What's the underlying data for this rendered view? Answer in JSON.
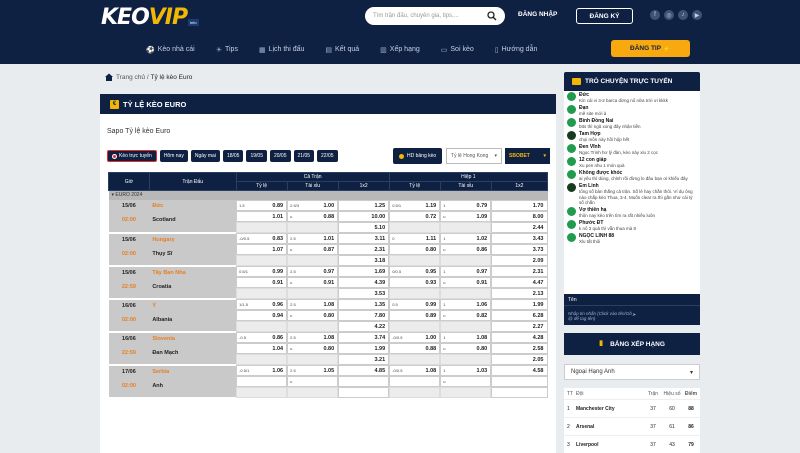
{
  "header": {
    "logo_main": "KEO",
    "logo_accent": "VIP",
    "logo_tag": "info",
    "search_placeholder": "Tìm trận đấu, chuyên gia, tips,...",
    "login_label": "ĐĂNG NHẬP",
    "register_label": "ĐĂNG KÝ",
    "socials": [
      "facebook-icon",
      "instagram-icon",
      "tiktok-icon",
      "youtube-icon"
    ]
  },
  "nav": {
    "items": [
      {
        "label": "Kèo nhà cái",
        "icon": "ball-icon"
      },
      {
        "label": "Tips",
        "icon": "lightbulb-icon"
      },
      {
        "label": "Lịch thi đấu",
        "icon": "calendar-icon"
      },
      {
        "label": "Kết quả",
        "icon": "scoreboard-icon"
      },
      {
        "label": "Xếp hạng",
        "icon": "ranking-icon"
      },
      {
        "label": "Soi kèo",
        "icon": "tv-icon"
      },
      {
        "label": "Hướng dẫn",
        "icon": "book-icon"
      }
    ],
    "dangtip_label": "ĐĂNG TIP"
  },
  "breadcrumb": {
    "home": "Trang chủ",
    "sep": "/",
    "current": "Tỷ lệ kèo Euro"
  },
  "main": {
    "title": "TỶ LỆ KÈO EURO",
    "sapo": "Sapo Tỷ lệ kèo Euro",
    "filters": [
      "Kèo trực tuyến",
      "Hôm nay",
      "Ngày mai",
      "18/05",
      "19/05",
      "20/05",
      "21/05",
      "22/05"
    ],
    "hd_label": "HD bảng kèo",
    "region_select": "Tỷ lệ Hong Kong",
    "bookmaker_select": "SBOBET"
  },
  "table": {
    "h_time": "Giờ",
    "h_match": "Trận Đấu",
    "h_full": "Cả Trận",
    "h_half": "Hiệp 1",
    "h_tyle": "Tỷ lệ",
    "h_taixiu": "Tài xỉu",
    "h_1x2": "1x2",
    "league": "EURO 2024",
    "matches": [
      {
        "date": "15/06",
        "time": "02:00",
        "home": "Đức",
        "away": "Scotland",
        "ft_hdp_line": "1.5",
        "ft_hdp_home": "0.89",
        "ft_hdp_away": "1.01",
        "ft_ou_line": "2.5/3",
        "ft_ou_over": "1.00",
        "ft_ou_under": "0.88",
        "ft_1x2": [
          "1.25",
          "10.00",
          "5.10"
        ],
        "h1_hdp_line": "0.5/1",
        "h1_hdp_home": "1.19",
        "h1_hdp_away": "0.72",
        "h1_ou_line": "1",
        "h1_ou_over": "0.79",
        "h1_ou_under": "1.09",
        "h1_1x2": [
          "1.70",
          "8.00",
          "2.44"
        ]
      },
      {
        "date": "15/06",
        "time": "02:00",
        "home": "Hungary",
        "away": "Thụy Sĩ",
        "ft_hdp_line": "-0/0.5",
        "ft_hdp_home": "0.83",
        "ft_hdp_away": "1.07",
        "ft_ou_line": "2.5",
        "ft_ou_over": "1.01",
        "ft_ou_under": "0.87",
        "ft_1x2": [
          "3.11",
          "2.31",
          "3.18"
        ],
        "h1_hdp_line": "0",
        "h1_hdp_home": "1.11",
        "h1_hdp_away": "0.80",
        "h1_ou_line": "1",
        "h1_ou_over": "1.02",
        "h1_ou_under": "0.86",
        "h1_1x2": [
          "3.43",
          "3.73",
          "2.09"
        ]
      },
      {
        "date": "15/06",
        "time": "22:59",
        "home": "Tây Ban Nha",
        "away": "Croatia",
        "ft_hdp_line": "0.5/1",
        "ft_hdp_home": "0.99",
        "ft_hdp_away": "0.91",
        "ft_ou_line": "2.5",
        "ft_ou_over": "0.97",
        "ft_ou_under": "0.91",
        "ft_1x2": [
          "1.69",
          "4.39",
          "3.53"
        ],
        "h1_hdp_line": "0/0.5",
        "h1_hdp_home": "0.95",
        "h1_hdp_away": "0.93",
        "h1_ou_line": "1",
        "h1_ou_over": "0.97",
        "h1_ou_under": "0.91",
        "h1_1x2": [
          "2.31",
          "4.47",
          "2.13"
        ]
      },
      {
        "date": "16/06",
        "time": "02:00",
        "home": "Ý",
        "away": "Albania",
        "ft_hdp_line": "1/1.5",
        "ft_hdp_home": "0.96",
        "ft_hdp_away": "0.94",
        "ft_ou_line": "2.5",
        "ft_ou_over": "1.08",
        "ft_ou_under": "0.80",
        "ft_1x2": [
          "1.35",
          "7.80",
          "4.22"
        ],
        "h1_hdp_line": "0.5",
        "h1_hdp_home": "0.99",
        "h1_hdp_away": "0.89",
        "h1_ou_line": "1",
        "h1_ou_over": "1.06",
        "h1_ou_under": "0.82",
        "h1_1x2": [
          "1.99",
          "6.28",
          "2.27"
        ]
      },
      {
        "date": "16/06",
        "time": "22:59",
        "home": "Slovenia",
        "away": "Đan Mạch",
        "ft_hdp_line": "-0.5",
        "ft_hdp_home": "0.86",
        "ft_hdp_away": "1.04",
        "ft_ou_line": "2.5",
        "ft_ou_over": "1.08",
        "ft_ou_under": "0.80",
        "ft_1x2": [
          "3.74",
          "1.99",
          "3.21"
        ],
        "h1_hdp_line": "-0/0.5",
        "h1_hdp_home": "1.00",
        "h1_hdp_away": "0.88",
        "h1_ou_line": "1",
        "h1_ou_over": "1.08",
        "h1_ou_under": "0.80",
        "h1_1x2": [
          "4.28",
          "2.58",
          "2.05"
        ]
      },
      {
        "date": "17/06",
        "time": "02:00",
        "home": "Serbia",
        "away": "Anh",
        "ft_hdp_line": "-0.5/1",
        "ft_hdp_home": "1.06",
        "ft_hdp_away": "",
        "ft_ou_line": "2.5",
        "ft_ou_over": "1.05",
        "ft_ou_under": "",
        "ft_1x2": [
          "4.85",
          "",
          ""
        ],
        "h1_hdp_line": "-0/0.5",
        "h1_hdp_home": "1.08",
        "h1_hdp_away": "",
        "h1_ou_line": "1",
        "h1_ou_over": "1.03",
        "h1_ou_under": "",
        "h1_1x2": [
          "4.58",
          "",
          ""
        ]
      }
    ]
  },
  "chat": {
    "title": "TRÒ CHUYỆN TRỰC TUYẾN",
    "messages": [
      {
        "name": "Đức",
        "text": "Kin cái vi 3-2 barca dừng nổ nữa trời ơi kkkk",
        "tall": false
      },
      {
        "name": "Đạn",
        "text": "mẽ site mới à",
        "tall": false
      },
      {
        "name": "Bình Đồng Nai",
        "text": "btts thì ngũ xong đây nhận tiền",
        "tall": false
      },
      {
        "name": "Tam Hợp",
        "text": "chọi mồn này hồi hộp hết",
        "tall": false
      },
      {
        "name": "Đen Vĩnh",
        "text": "Ngọc Trinh hơ lý đàn, kèo này xỉu 2 cọc",
        "tall": false
      },
      {
        "name": "12 con giáp",
        "text": "Xu pen nhu 1 món quà",
        "tall": false
      },
      {
        "name": "Không được khóc",
        "text": "ai yêu thì dùng, chỉnh rồi đừng lo đâu bạn ơi khiếu đây",
        "tall": false
      },
      {
        "name": "Em Linh",
        "text": "tổng số bàn thắng cả trận. Số lẻ hay chẵn thôi. Ví dụ ông nào chắp kèo Thua, 3-4. Muốn clear ra thì gần như cái tỷ số chẵn",
        "tall": true
      },
      {
        "name": "Vợ thiên hạ",
        "text": "thôn nay kèo trên tìm ra rất nhiều luôn",
        "tall": false
      },
      {
        "name": "Phước ĐT",
        "text": "k nổ 3 quả thì vẫn thua mà 8",
        "tall": false
      },
      {
        "name": "NGỌC LINH 88",
        "text": "Xỉu tất thôi",
        "tall": false
      }
    ],
    "name_label": "Tên",
    "input_placeholder": "Nhập tin nhắn (Click vào tên/Gõ @ để tag tên)"
  },
  "ranking": {
    "title": "BẢNG XẾP HẠNG",
    "league_select": "Ngoại Hạng Anh",
    "headers": {
      "tt": "TT",
      "team": "Đội",
      "played": "Trận",
      "gd": "Hiệu số",
      "points": "Điểm"
    },
    "rows": [
      {
        "pos": "1",
        "team": "Manchester City",
        "played": "37",
        "gd": "60",
        "points": "88"
      },
      {
        "pos": "2",
        "team": "Arsenal",
        "played": "37",
        "gd": "61",
        "points": "86"
      },
      {
        "pos": "3",
        "team": "Liverpool",
        "played": "37",
        "gd": "43",
        "points": "79"
      }
    ]
  }
}
